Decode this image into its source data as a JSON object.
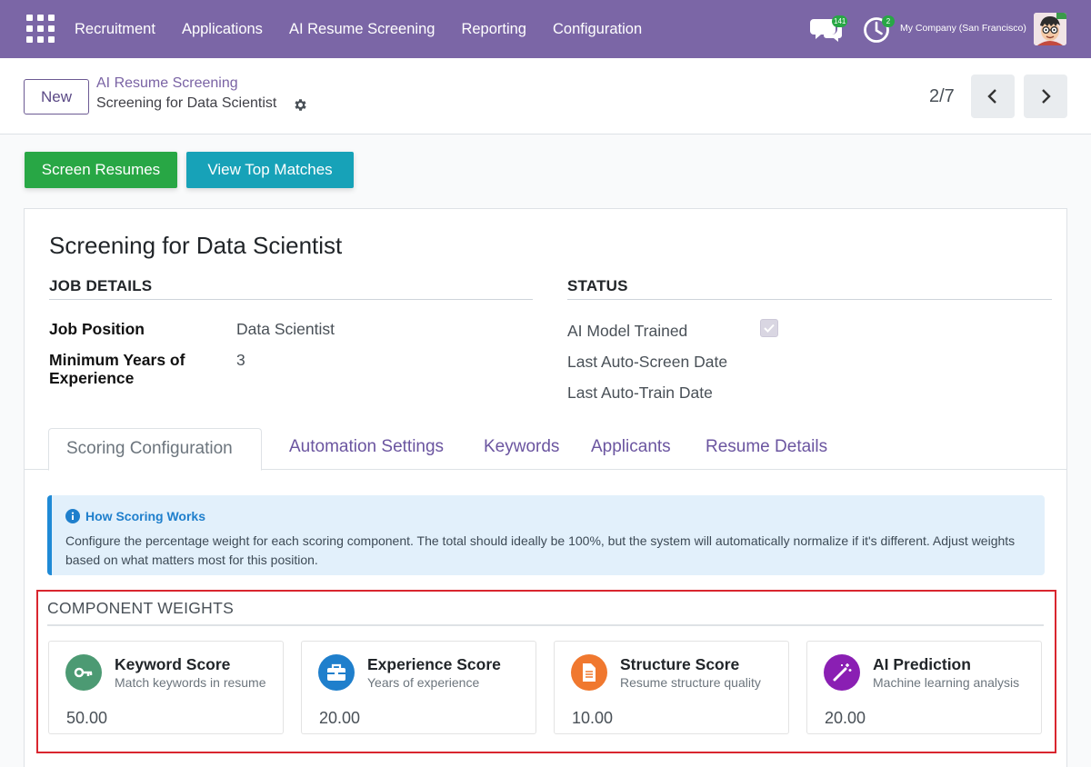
{
  "navbar": {
    "menu": [
      "Recruitment",
      "Applications",
      "AI Resume Screening",
      "Reporting",
      "Configuration"
    ],
    "chat_badge": "141",
    "activity_badge": "2",
    "company": "My Company (San Francisco)",
    "colors": {
      "navbar_bg": "#7b66a6",
      "badge": "#28a745"
    }
  },
  "control_panel": {
    "new_button": "New",
    "breadcrumb_parent": "AI Resume Screening",
    "breadcrumb_current": "Screening for Data Scientist",
    "pager": "2/7"
  },
  "actions": {
    "screen_resumes": "Screen Resumes",
    "view_top_matches": "View Top Matches",
    "colors": {
      "screen_resumes": "#28a745",
      "view_top_matches": "#17a2b8"
    }
  },
  "form": {
    "title": "Screening for Data Scientist",
    "job_details": {
      "heading": "JOB DETAILS",
      "job_position_label": "Job Position",
      "job_position_value": "Data Scientist",
      "min_years_label": "Minimum Years of Experience",
      "min_years_value": "3"
    },
    "status": {
      "heading": "STATUS",
      "ai_model_trained_label": "AI Model Trained",
      "ai_model_trained_checked": true,
      "last_auto_screen_label": "Last Auto-Screen Date",
      "last_auto_train_label": "Last Auto-Train Date"
    },
    "tabs": [
      "Scoring Configuration",
      "Automation Settings",
      "Keywords",
      "Applicants",
      "Resume Details"
    ],
    "active_tab": "Scoring Configuration",
    "alert": {
      "title": "How Scoring Works",
      "text": "Configure the percentage weight for each scoring component. The total should ideally be 100%, but the system will automatically normalize if it's different. Adjust weights based on what matters most for this position."
    },
    "component_weights": {
      "heading": "COMPONENT WEIGHTS",
      "cards": [
        {
          "title": "Keyword Score",
          "subtitle": "Match keywords in resume",
          "value": "50.00",
          "icon": "key-icon",
          "color": "#4c9a73"
        },
        {
          "title": "Experience Score",
          "subtitle": "Years of experience",
          "value": "20.00",
          "icon": "briefcase-icon",
          "color": "#1f7fcc"
        },
        {
          "title": "Structure Score",
          "subtitle": "Resume structure quality",
          "value": "10.00",
          "icon": "document-icon",
          "color": "#f0782f"
        },
        {
          "title": "AI Prediction",
          "subtitle": "Machine learning analysis",
          "value": "20.00",
          "icon": "magic-wand-icon",
          "color": "#8a1fb3"
        }
      ]
    }
  }
}
